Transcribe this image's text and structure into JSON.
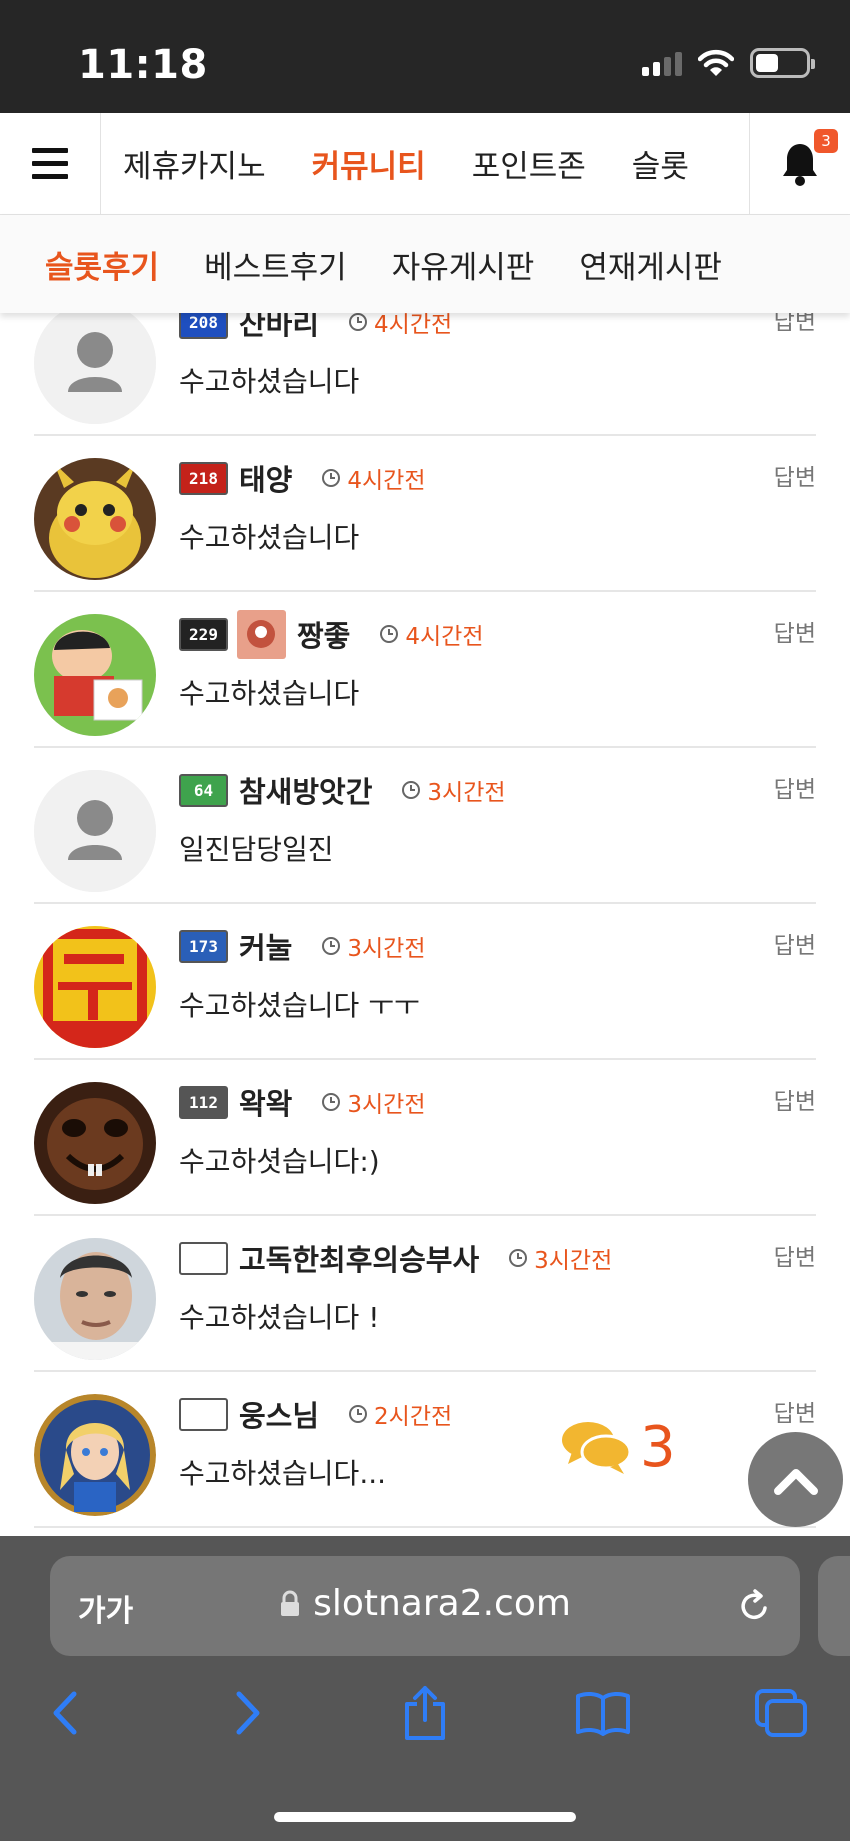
{
  "status_bar": {
    "time": "11:18",
    "battery_level": 0.45
  },
  "top_nav": {
    "items": [
      "제휴카지노",
      "커뮤니티",
      "포인트존",
      "슬롯"
    ],
    "active_index": 1,
    "notification_count": "3"
  },
  "sub_nav": {
    "items": [
      "슬롯후기",
      "베스트후기",
      "자유게시판",
      "연재게시판"
    ],
    "active_index": 0
  },
  "comments": [
    {
      "level": "208",
      "username": "산바리",
      "time": "4시간전",
      "reply": "답변",
      "text": "수고하셨습니다",
      "badge_color": "#1f4fbf",
      "avatar": "default"
    },
    {
      "level": "218",
      "username": "태양",
      "time": "4시간전",
      "reply": "답변",
      "text": "수고하셨습니다",
      "badge_color": "#c4221a",
      "avatar": "pikachu"
    },
    {
      "level": "229",
      "username": "짱좋",
      "time": "4시간전",
      "reply": "답변",
      "text": "수고하셨습니다",
      "badge_color": "#222222",
      "avatar": "shinchan"
    },
    {
      "level": "64",
      "username": "참새방앗간",
      "time": "3시간전",
      "reply": "답변",
      "text": "일진담당일진",
      "badge_color": "#3fa34d",
      "avatar": "default"
    },
    {
      "level": "173",
      "username": "커눌",
      "time": "3시간전",
      "reply": "답변",
      "text": "수고하셨습니다 ㅜㅜ",
      "badge_color": "#2a5fb8",
      "avatar": "poster"
    },
    {
      "level": "112",
      "username": "왁왁",
      "time": "3시간전",
      "reply": "답변",
      "text": "수고하셧습니다:)",
      "badge_color": "#555555",
      "avatar": "creature"
    },
    {
      "level": "",
      "username": "고독한최후의승부사",
      "time": "3시간전",
      "reply": "답변",
      "text": "수고하셨습니다 !",
      "badge_color": "#ffffff",
      "avatar": "man"
    },
    {
      "level": "",
      "username": "웅스님",
      "time": "2시간전",
      "reply": "답변",
      "text": "수고하셨습니다...",
      "badge_color": "#ffffff",
      "avatar": "girl"
    }
  ],
  "floating": {
    "comment_count": "3"
  },
  "browser": {
    "aa_label": "가가",
    "url": "slotnara2.com"
  },
  "colors": {
    "accent": "#e8551d",
    "comment_bubble": "#f2b630"
  }
}
